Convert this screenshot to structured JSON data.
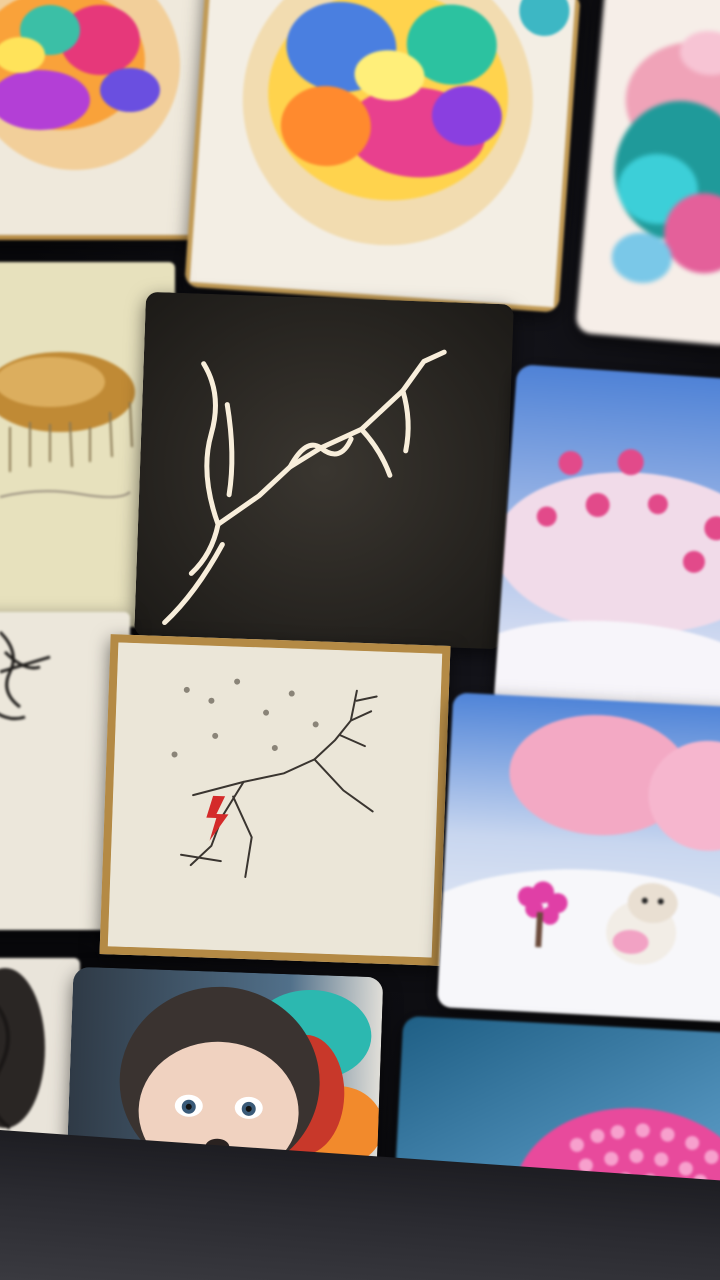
{
  "gallery": {
    "items": [
      {
        "subject": "watercolor-circle-1"
      },
      {
        "subject": "watercolor-circle-2"
      },
      {
        "subject": "watercolor-splash"
      },
      {
        "subject": "sepia-pencil-sketch"
      },
      {
        "subject": "lightning-sketch-dark"
      },
      {
        "subject": "pink-snow-fluff"
      },
      {
        "subject": "ink-scribble"
      },
      {
        "subject": "framed-reindeer-sketch"
      },
      {
        "subject": "snow-creatures-pink-trees"
      },
      {
        "subject": "hair-portrait-left"
      },
      {
        "subject": "girl-dog-face-portrait"
      },
      {
        "subject": "pink-coral-sphere"
      }
    ]
  },
  "colors": {
    "background": "#0b0b0f",
    "gold_frame": "#b48a45",
    "snow_pink": "#e24a8a",
    "sky_blue": "#5b8fd6"
  }
}
